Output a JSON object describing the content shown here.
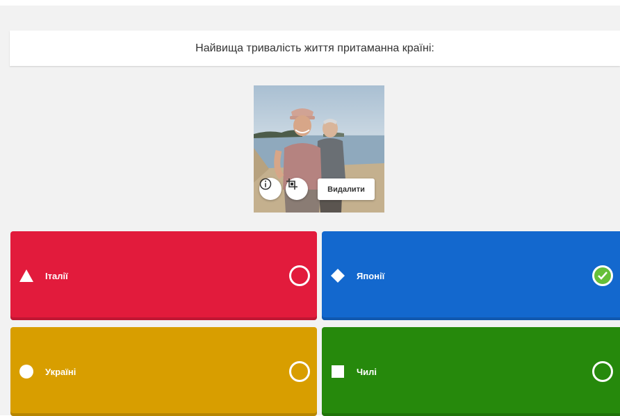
{
  "question": {
    "text": "Найвища тривалість життя притаманна країні:"
  },
  "media": {
    "delete_label": "Видалити",
    "info_icon": "info-icon",
    "crop_icon": "crop-icon"
  },
  "answers": [
    {
      "label": "Італії",
      "shape": "triangle-icon",
      "color": "#e21b3c",
      "correct": false
    },
    {
      "label": "Японії",
      "shape": "diamond-icon",
      "color": "#1368ce",
      "correct": true
    },
    {
      "label": "Україні",
      "shape": "circle-icon",
      "color": "#d89e00",
      "correct": false
    },
    {
      "label": "Чилі",
      "shape": "square-icon",
      "color": "#26890c",
      "correct": false
    }
  ]
}
